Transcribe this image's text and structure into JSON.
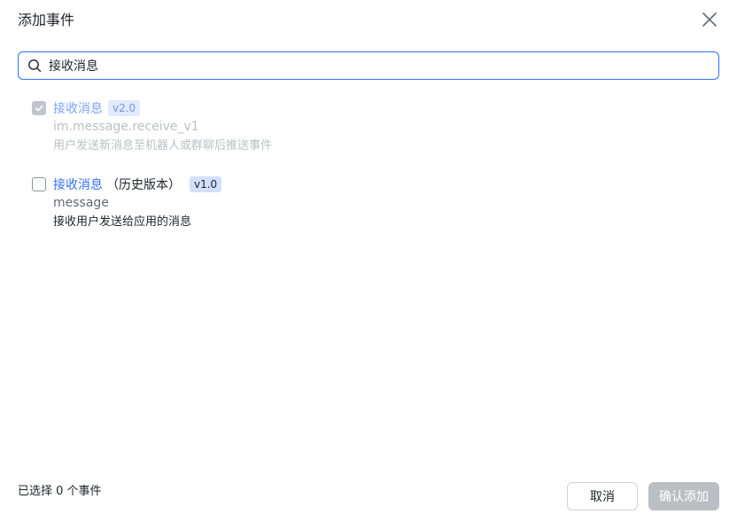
{
  "dialog": {
    "title": "添加事件"
  },
  "search": {
    "value": "接收消息"
  },
  "events": [
    {
      "name": "接收消息",
      "suffix": "",
      "version": "v2.0",
      "key": "im.message.receive_v1",
      "description": "用户发送新消息至机器人或群聊后推送事件",
      "checked": true,
      "disabled": true
    },
    {
      "name": "接收消息",
      "suffix": "（历史版本）",
      "version": "v1.0",
      "key": "message",
      "description": "接收用户发送给应用的消息",
      "checked": false,
      "disabled": false
    }
  ],
  "footer": {
    "selected_text": "已选择 0 个事件",
    "cancel_label": "取消",
    "confirm_label": "确认添加"
  },
  "colors": {
    "accent": "#3370ff",
    "disabled_button": "#bbbfc4"
  }
}
